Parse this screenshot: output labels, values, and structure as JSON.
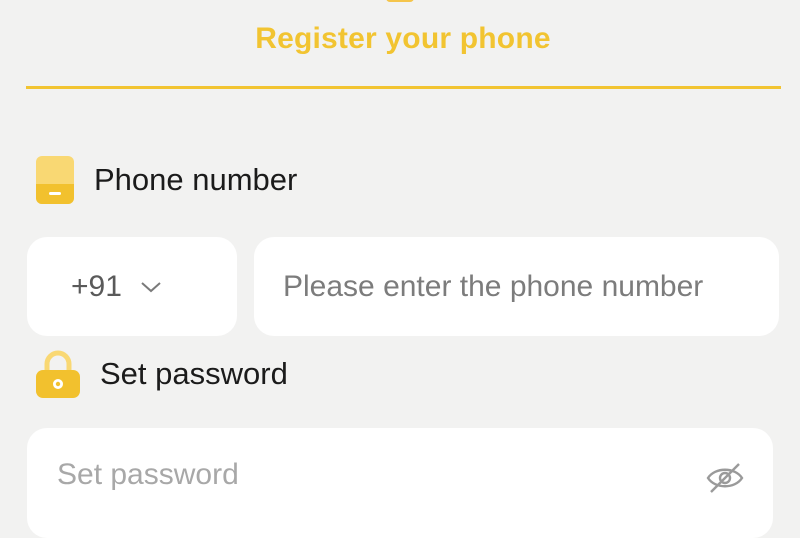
{
  "header": {
    "title": "Register your phone",
    "accent_color": "#f2c431"
  },
  "phone_section": {
    "label": "Phone number",
    "icon": "phone-icon",
    "country_code": {
      "value": "+91",
      "icon": "chevron-down-icon"
    },
    "input": {
      "value": "",
      "placeholder": "Please enter the phone number"
    }
  },
  "password_section": {
    "label": "Set password",
    "icon": "lock-icon",
    "input": {
      "value": "",
      "placeholder": "Set password"
    },
    "visibility_toggle_icon": "eye-off-icon"
  }
}
